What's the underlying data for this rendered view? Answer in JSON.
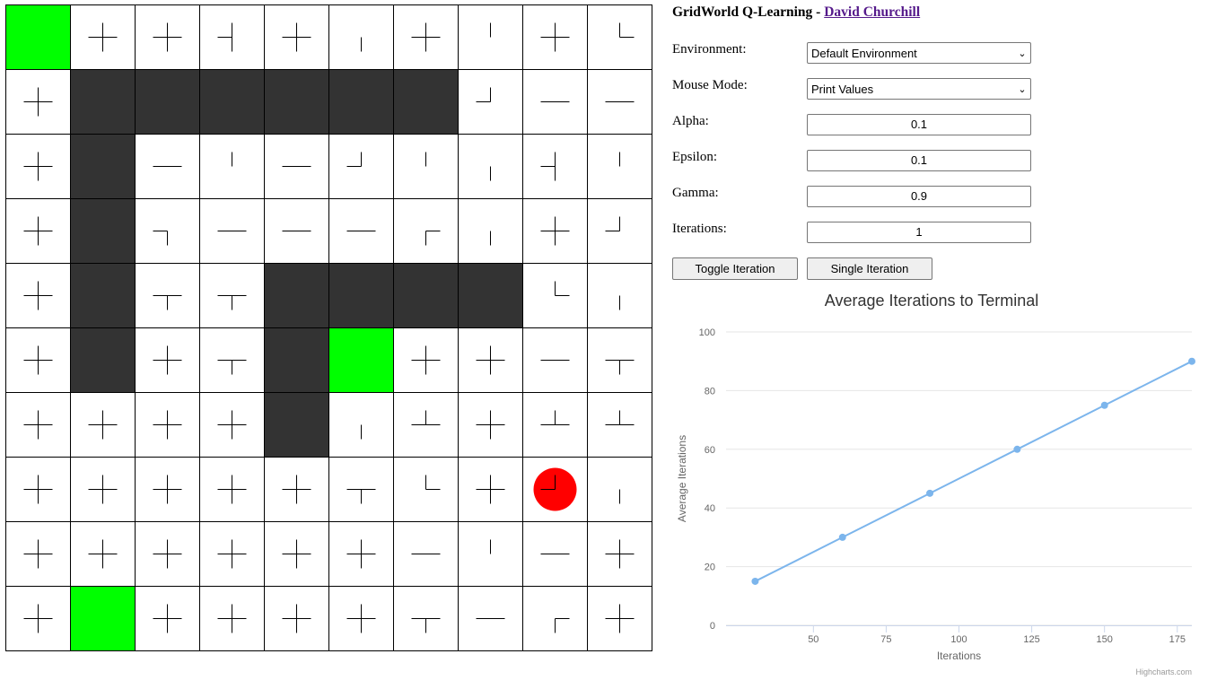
{
  "header": {
    "title": "GridWorld Q-Learning - ",
    "author_link": "David Churchill"
  },
  "controls": {
    "environment_label": "Environment:",
    "environment_value": "Default Environment",
    "mouse_mode_label": "Mouse Mode:",
    "mouse_mode_value": "Print Values",
    "alpha_label": "Alpha:",
    "alpha_value": "0.1",
    "epsilon_label": "Epsilon:",
    "epsilon_value": "0.1",
    "gamma_label": "Gamma:",
    "gamma_value": "0.9",
    "iterations_label": "Iterations:",
    "iterations_value": "1",
    "toggle_button": "Toggle Iteration",
    "single_button": "Single Iteration"
  },
  "grid": {
    "rows": 10,
    "cols": 10,
    "cells": [
      [
        "G",
        "+",
        "+",
        "UDL",
        "+",
        "D",
        "+",
        "U",
        "+",
        "UR"
      ],
      [
        "+",
        "W",
        "W",
        "W",
        "W",
        "W",
        "W",
        "UL",
        "LR",
        "LR"
      ],
      [
        "+",
        "W",
        "LR",
        "U",
        "LR",
        "UL",
        "U",
        "D",
        "UDL",
        "U"
      ],
      [
        "+",
        "W",
        "DL",
        "LR",
        "LR",
        "LR",
        "DR",
        "D",
        "+",
        "UL"
      ],
      [
        "+",
        "W",
        "DLR",
        "DLR",
        "W",
        "W",
        "W",
        "W",
        "UR",
        "D"
      ],
      [
        "+",
        "W",
        "+",
        "DLR",
        "W",
        "G",
        "+",
        "+",
        "LR",
        "DLR"
      ],
      [
        "+",
        "+",
        "+",
        "+",
        "W",
        "D",
        "ULR",
        "+",
        "ULR",
        "ULR"
      ],
      [
        "+",
        "+",
        "+",
        "+",
        "+",
        "DLR",
        "UR",
        "+",
        "UL",
        "D"
      ],
      [
        "+",
        "+",
        "+",
        "+",
        "+",
        "+",
        "LR",
        "U",
        "LR",
        "+"
      ],
      [
        "+",
        "G",
        "+",
        "+",
        "+",
        "+",
        "DLR",
        "LR",
        "DR",
        "+"
      ]
    ],
    "agent": {
      "row": 7,
      "col": 8
    },
    "colors": {
      "wall": "#333333",
      "goal": "#00ff00",
      "agent": "#ff0000",
      "line": "#000000"
    }
  },
  "chart_data": {
    "type": "line",
    "title": "Average Iterations to Terminal",
    "xlabel": "Iterations",
    "ylabel": "Average Iterations",
    "x": [
      30,
      60,
      90,
      120,
      150,
      180
    ],
    "series": [
      {
        "values": [
          15,
          30,
          45,
          60,
          75,
          90
        ]
      }
    ],
    "xlim": [
      30,
      180
    ],
    "ylim": [
      0,
      100
    ],
    "x_ticks": [
      "50",
      "75",
      "100",
      "125",
      "150",
      "175"
    ],
    "y_ticks": [
      "0",
      "20",
      "40",
      "60",
      "80",
      "100"
    ],
    "grid": true,
    "legend": "none",
    "color": "#7cb5ec",
    "credits": "Highcharts.com"
  }
}
